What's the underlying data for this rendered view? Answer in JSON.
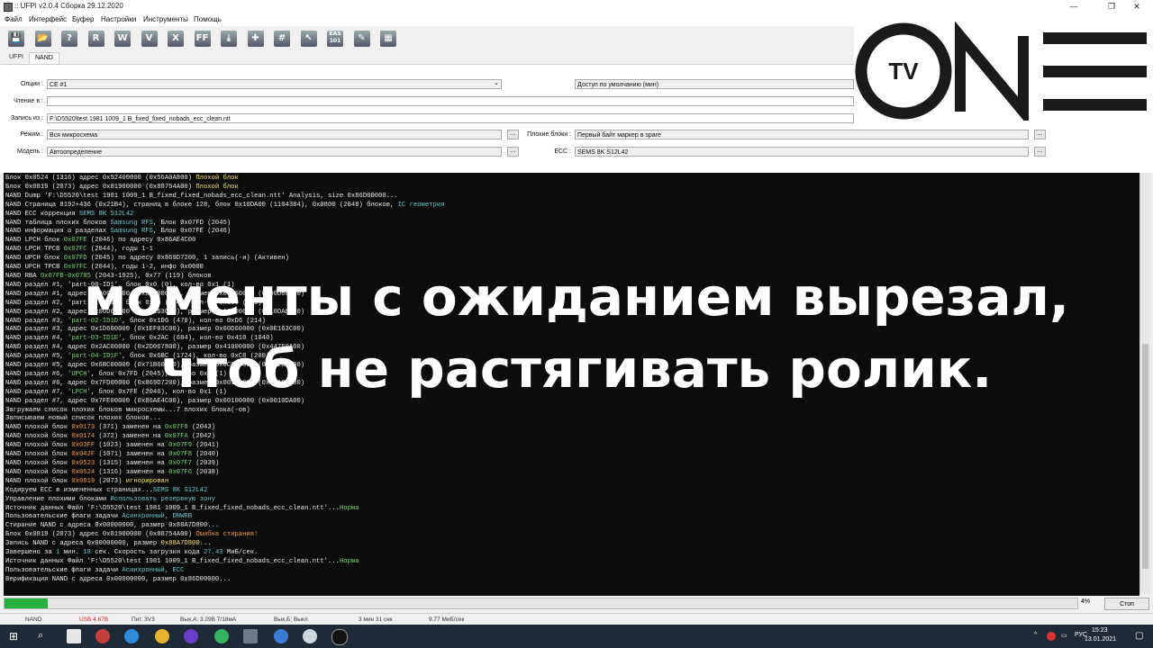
{
  "window": {
    "title": ":: UFPI v2.0.4 Сборка 29.12.2020",
    "minimize": "—",
    "maximize": "❐",
    "close": "✕"
  },
  "menu": [
    "Файл",
    "Интерфейс",
    "Буфер",
    "Настройки",
    "Инструменты",
    "Помощь"
  ],
  "toolbar": [
    {
      "icon": "save-icon",
      "glyph": "💾"
    },
    {
      "icon": "open-folder-icon",
      "glyph": "📂"
    },
    {
      "icon": "identify-icon",
      "glyph": "?"
    },
    {
      "icon": "read-icon",
      "glyph": "R"
    },
    {
      "icon": "write-icon",
      "glyph": "W"
    },
    {
      "icon": "verify-icon",
      "glyph": "V"
    },
    {
      "icon": "erase-icon",
      "glyph": "X"
    },
    {
      "icon": "ff-icon",
      "glyph": "FF"
    },
    {
      "icon": "download-icon",
      "glyph": "⤓"
    },
    {
      "icon": "plugin-icon",
      "glyph": "✚"
    },
    {
      "icon": "chip-icon",
      "glyph": "#"
    },
    {
      "icon": "cursor-icon",
      "glyph": "↖"
    },
    {
      "icon": "eas-icon",
      "glyph": "EAS 101"
    },
    {
      "icon": "edit-icon",
      "glyph": "✎"
    },
    {
      "icon": "grid-icon",
      "glyph": "▦"
    }
  ],
  "tabs": {
    "ufpi": "UFPI",
    "nand": "NAND"
  },
  "form": {
    "options_label": "Опции :",
    "options_value": "CE #1",
    "access_value": "Доступ по умолчанию (мин)",
    "read_label": "Чтение в :",
    "write_label": "Запись из :",
    "write_value": "F:\\D5520\\test 1981 1009_1 B_fixed_fixed_nobads_ecc_clean.ntt",
    "mode_label": "Режим :",
    "mode_value": "Вся микросхема",
    "badblocks_label": "Плохие блоки :",
    "badblocks_value": "Первый байт маркер в spare",
    "model_label": "Модель :",
    "model_value": "Автоопределение",
    "ecc_label": "ECC :",
    "ecc_value": "SEMS 8K S12L42",
    "dots": "..."
  },
  "log": [
    [
      [
        "Блок 0x0524 (1316) адрес 0x52400000 (0x56A0A800) ",
        ""
      ],
      [
        "Плохой блок",
        "yellow"
      ]
    ],
    [
      [
        "Блок 0x0819 (2073) адрес 0x81900000 (0x88754A00) ",
        ""
      ],
      [
        "Плохой блок",
        "yellow"
      ]
    ],
    [
      [
        "NAND Dump 'F:\\D5520\\test 1981 1009_1 B_fixed_fixed_nobads_ecc_clean.ntt' Analysis, size 0x86D00000...",
        ""
      ]
    ],
    [
      [
        "NAND Страница 8192+436 (0x21B4), страниц в блоке 128, блок 0x10DA00 (1104384), 0x0800 (2048) блоков, ",
        ""
      ],
      [
        "IC геометрия",
        "teal"
      ]
    ],
    [
      [
        "NAND ECC коррекция ",
        ""
      ],
      [
        "SEMS 8K S12L42",
        "teal"
      ]
    ],
    [
      [
        "NAND таблица плохих блоков ",
        ""
      ],
      [
        "Samsung RFS",
        "teal"
      ],
      [
        ", Блок 0x07FD (2045)",
        ""
      ]
    ],
    [
      [
        "NAND информация о разделах ",
        ""
      ],
      [
        "Samsung RFS",
        "teal"
      ],
      [
        ", Блок 0x07FE (2046)",
        ""
      ]
    ],
    [
      [
        "NAND LPCH блок ",
        ""
      ],
      [
        "0x07FE",
        "green"
      ],
      [
        " (2046) по адресу 0x86AE4C00",
        ""
      ]
    ],
    [
      [
        "NAND LPCH TPCB ",
        ""
      ],
      [
        "0x07FC",
        "green"
      ],
      [
        " (2044), годы 1-1",
        ""
      ]
    ],
    [
      [
        "NAND UPCH блок ",
        ""
      ],
      [
        "0x07FD",
        "green"
      ],
      [
        " (2045) по адресу 0x869D7200, 1 запись(-и) (Активен)",
        ""
      ]
    ],
    [
      [
        "NAND UPCH TPCB ",
        ""
      ],
      [
        "0x07FC",
        "green"
      ],
      [
        " (2044), годы 1-2, инфо 0x0000",
        ""
      ]
    ],
    [
      [
        "NAND RBA ",
        ""
      ],
      [
        "0x07FB-0x0785",
        "green"
      ],
      [
        " (2043-1925), 0x77 (119) блоков",
        ""
      ]
    ],
    [
      [
        "NAND раздел #1, 'part-00-ID1', блок 0x0 (0), кол-во 0x1 (1)",
        ""
      ]
    ],
    [
      [
        "NAND раздел #1, адрес 0x00000000 (0x00000000), размер 0x00D60000 (0x00D60000)",
        ""
      ]
    ],
    [
      [
        "NAND раздел #2, 'part-01-ID1', блок 0xD6 (214), кол-во 0x100 (256)",
        ""
      ]
    ],
    [
      [
        "NAND раздел #2, адрес 0x00D60000 (0x0E163C00), размер 0x10000000 (0x10DA0000)",
        ""
      ]
    ],
    [
      [
        "NAND раздел #3, ",
        ""
      ],
      [
        "'part-02-ID1D'",
        "green"
      ],
      [
        ", блок 0x1D6 (470), кол-во 0xD6 (214)",
        ""
      ]
    ],
    [
      [
        "NAND раздел #3, адрес 0x1D600000 (0x1EF03C00), размер 0x00D60000 (0x0E163C00)",
        ""
      ]
    ],
    [
      [
        "NAND раздел #4, ",
        ""
      ],
      [
        "'part-03-ID1E'",
        "green"
      ],
      [
        ", блок 0x2AC (684), кол-во 0x410 (1040)",
        ""
      ]
    ],
    [
      [
        "NAND раздел #4, адрес 0x2AC00000 (0x2D067800), размер 0x41000000 (0x44750A00)",
        ""
      ]
    ],
    [
      [
        "NAND раздел #5, ",
        ""
      ],
      [
        "'part-04-ID1F'",
        "green"
      ],
      [
        ", блок 0x6BC (1724), кол-во 0xC8 (200)",
        ""
      ]
    ],
    [
      [
        "NAND раздел #5, адрес 0x6BC00000 (0x71B60A00), размер 0x0C800000 (0x0D2E6800)",
        ""
      ]
    ],
    [
      [
        "NAND раздел #6, ",
        ""
      ],
      [
        "'UPCH'",
        "green"
      ],
      [
        ", блок 0x7FD (2045), кол-во 0x1 (1)",
        ""
      ]
    ],
    [
      [
        "NAND раздел #6, адрес 0x7FD00000 (0x869D7200), размер 0x00100000 (0x0010DA00)",
        ""
      ]
    ],
    [
      [
        "NAND раздел #7, ",
        ""
      ],
      [
        "'LPCH'",
        "green"
      ],
      [
        ", блок 0x7FE (2046), кол-во 0x1 (1)",
        ""
      ]
    ],
    [
      [
        "NAND раздел #7, адрес 0x7FE00000 (0x86AE4C00), размер 0x00100000 (0x0010DA00)",
        ""
      ]
    ],
    [
      [
        "Загружаем список плохих блоков микросхемы...7 плохих блока(-ов)",
        ""
      ]
    ],
    [
      [
        "Записываем новый список плохих блоков...",
        ""
      ]
    ],
    [
      [
        "NAND плохой блок ",
        ""
      ],
      [
        "0x0173",
        "orange"
      ],
      [
        " (371) заменен на ",
        ""
      ],
      [
        "0x07F8",
        "green"
      ],
      [
        " (2043)",
        ""
      ]
    ],
    [
      [
        "NAND плохой блок ",
        ""
      ],
      [
        "0x0174",
        "orange"
      ],
      [
        " (372) заменен на ",
        ""
      ],
      [
        "0x07FA",
        "green"
      ],
      [
        " (2042)",
        ""
      ]
    ],
    [
      [
        "NAND плохой блок ",
        ""
      ],
      [
        "0x03FF",
        "orange"
      ],
      [
        " (1023) заменен на ",
        ""
      ],
      [
        "0x07F9",
        "green"
      ],
      [
        " (2041)",
        ""
      ]
    ],
    [
      [
        "NAND плохой блок ",
        ""
      ],
      [
        "0x042F",
        "orange"
      ],
      [
        " (1071) заменен на ",
        ""
      ],
      [
        "0x07F8",
        "green"
      ],
      [
        " (2040)",
        ""
      ]
    ],
    [
      [
        "NAND плохой блок ",
        ""
      ],
      [
        "0x0523",
        "orange"
      ],
      [
        " (1315) заменен на ",
        ""
      ],
      [
        "0x07F7",
        "green"
      ],
      [
        " (2039)",
        ""
      ]
    ],
    [
      [
        "NAND плохой блок ",
        ""
      ],
      [
        "0x0524",
        "orange"
      ],
      [
        " (1316) заменен на ",
        ""
      ],
      [
        "0x07F6",
        "green"
      ],
      [
        " (2038)",
        ""
      ]
    ],
    [
      [
        "NAND плохой блок ",
        ""
      ],
      [
        "0x0819",
        "orange"
      ],
      [
        " (2073) ",
        ""
      ],
      [
        "игнорирован",
        "yellow"
      ]
    ],
    [
      [
        "Кодируем ECC в измененных страницах...",
        ""
      ],
      [
        "SEMS 8K S12L42",
        "teal"
      ]
    ],
    [
      [
        "Управление плохими блоками ",
        ""
      ],
      [
        "Использовать резервную зону",
        "teal"
      ]
    ],
    [
      [
        "Источник данных Файл 'F:\\D5520\\test 1981 1009_1 B_fixed_fixed_nobads_ecc_clean.ntt'...",
        ""
      ],
      [
        "Норма",
        "green"
      ]
    ],
    [
      [
        "Пользовательские флаги задачи ",
        ""
      ],
      [
        "Асинхронный, DNWRB",
        "teal"
      ]
    ],
    [
      [
        "Стирание NAND с адреса 0x00000000, размер 0x88A7D800...",
        ""
      ]
    ],
    [
      [
        "Блок 0x0819 (2073) адрес 0x81900000 (0x88754A00) ",
        ""
      ],
      [
        "Ошибка стирания!",
        "orange"
      ]
    ],
    [
      [
        "Запись NAND с адреса 0x00000000, размер ",
        ""
      ],
      [
        "0x88A7D800",
        "yellow"
      ],
      [
        "...",
        ""
      ]
    ],
    [
      [
        "Завершено за ",
        ""
      ],
      [
        "1",
        "teal"
      ],
      [
        " мин. ",
        ""
      ],
      [
        "18",
        "teal"
      ],
      [
        " сек. Скорость загрузки кода ",
        ""
      ],
      [
        "27.43",
        "teal"
      ],
      [
        " МиБ/сек.",
        ""
      ]
    ],
    [
      [
        "Источник данных Файл 'F:\\D5520\\test 1981 1009_1 B_fixed_fixed_nobads_ecc_clean.ntt'...",
        ""
      ],
      [
        "Норма",
        "green"
      ]
    ],
    [
      [
        "Пользовательские флаги задачи ",
        ""
      ],
      [
        "Асинхронный, ECC",
        "teal"
      ]
    ],
    [
      [
        "Верификация NAND с адреса 0x00000000, размер 0x86D00000...",
        ""
      ]
    ]
  ],
  "overlay": {
    "line1": "моменты с ожиданием вырезал,",
    "line2": "чтоб не растягивать ролик."
  },
  "logo": {
    "tv": "TV"
  },
  "progress": {
    "percent": 4,
    "percent_label": "4%",
    "stop_label": "Стоп"
  },
  "status": [
    "NAND",
    "USB 4.67В",
    "Пит. 3V3",
    "Вых.А: 3.29В 7/18мА",
    "Вых.Б: Выкл",
    "3 мин 31 сек",
    "9.77 МиБ/сек"
  ],
  "taskbar": {
    "lang": "РУС",
    "time": "15:23",
    "date": "13.01.2021"
  },
  "colors": {
    "log_bg": "#0c0c0c",
    "progress_fill": "#26b13f",
    "taskbar_bg": "#1f2a36"
  }
}
